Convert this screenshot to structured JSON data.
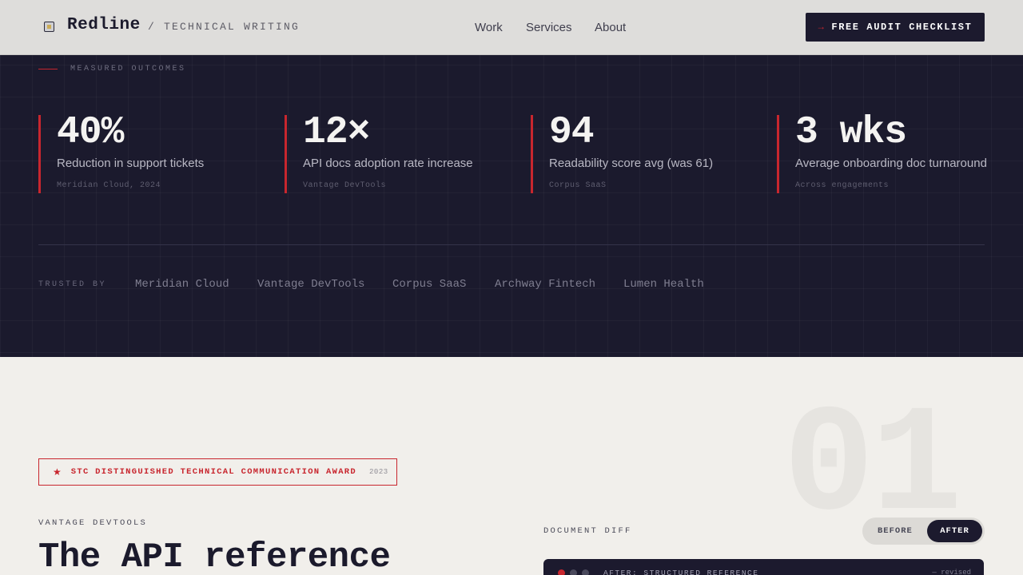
{
  "header": {
    "brand": "Redline",
    "brand_sub": "/ TECHNICAL WRITING",
    "nav": [
      "Work",
      "Services",
      "About"
    ],
    "cta_arrow": "→",
    "cta_label": "FREE AUDIT CHECKLIST"
  },
  "outcomes": {
    "label": "MEASURED OUTCOMES",
    "stats": [
      {
        "value": "40%",
        "desc": "Reduction in support tickets",
        "source": "Meridian Cloud, 2024"
      },
      {
        "value": "12×",
        "desc": "API docs adoption rate increase",
        "source": "Vantage DevTools"
      },
      {
        "value": "94",
        "desc": "Readability score avg (was 61)",
        "source": "Corpus SaaS"
      },
      {
        "value": "3 wks",
        "desc": "Average onboarding doc turnaround",
        "source": "Across engagements"
      }
    ],
    "trusted_label": "TRUSTED BY",
    "clients": [
      "Meridian Cloud",
      "Vantage DevTools",
      "Corpus SaaS",
      "Archway Fintech",
      "Lumen Health"
    ]
  },
  "case_study": {
    "number": "01",
    "award_icon": "star-icon",
    "award_text": "STC DISTINGUISHED TECHNICAL COMMUNICATION AWARD",
    "award_year": "2023",
    "client": "VANTAGE DEVTOOLS",
    "title": "The API reference",
    "diff_label": "DOCUMENT DIFF",
    "toggle": {
      "before": "BEFORE",
      "after": "AFTER"
    },
    "window_title": "AFTER: STRUCTURED REFERENCE",
    "window_status": "— revised"
  },
  "colors": {
    "accent": "#c8262e",
    "dark": "#1b1a2d",
    "light": "#f1efeb"
  }
}
